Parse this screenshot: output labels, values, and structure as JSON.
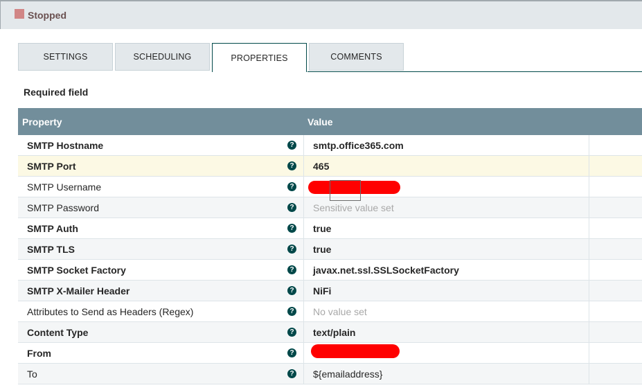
{
  "status": {
    "label": "Stopped",
    "color": "#d18686"
  },
  "tabs": [
    {
      "label": "SETTINGS",
      "active": false
    },
    {
      "label": "SCHEDULING",
      "active": false
    },
    {
      "label": "PROPERTIES",
      "active": true
    },
    {
      "label": "COMMENTS",
      "active": false
    }
  ],
  "required_label": "Required field",
  "table": {
    "headers": {
      "property": "Property",
      "value": "Value"
    },
    "rows": [
      {
        "name": "SMTP Hostname",
        "value": "smtp.office365.com",
        "required": true
      },
      {
        "name": "SMTP Port",
        "value": "465",
        "required": true
      },
      {
        "name": "SMTP Username",
        "value": "",
        "required": false,
        "redacted": true
      },
      {
        "name": "SMTP Password",
        "value": "Sensitive value set",
        "required": false
      },
      {
        "name": "SMTP Auth",
        "value": "true",
        "required": true
      },
      {
        "name": "SMTP TLS",
        "value": "true",
        "required": true
      },
      {
        "name": "SMTP Socket Factory",
        "value": "javax.net.ssl.SSLSocketFactory",
        "required": true
      },
      {
        "name": "SMTP X-Mailer Header",
        "value": "NiFi",
        "required": true
      },
      {
        "name": "Attributes to Send as Headers (Regex)",
        "value": "No value set",
        "required": false
      },
      {
        "name": "Content Type",
        "value": "text/plain",
        "required": true
      },
      {
        "name": "From",
        "value": "",
        "required": true,
        "redacted": true
      },
      {
        "name": "To",
        "value": "${emailaddress}",
        "required": false
      }
    ]
  },
  "help_icon": "question-circle-icon",
  "redaction_color": "#ff0000"
}
